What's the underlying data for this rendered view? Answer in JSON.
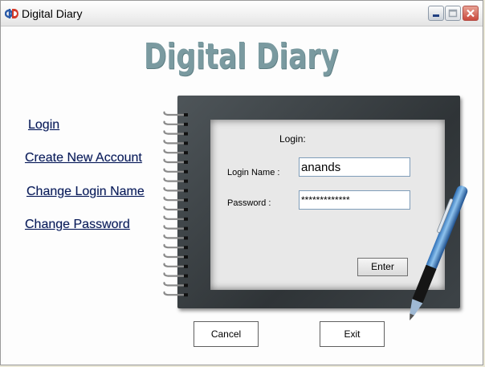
{
  "window": {
    "title": "Digital Diary",
    "icon_name": "digital-diary-app-icon",
    "controls": [
      "minimize-icon",
      "maximize-icon",
      "close-icon"
    ]
  },
  "header": {
    "app_title": "Digital Diary"
  },
  "sidebar": {
    "links": [
      {
        "label": "Login"
      },
      {
        "label": "Create New Account"
      },
      {
        "label": "Change Login Name"
      },
      {
        "label": "Change Password"
      }
    ]
  },
  "login_panel": {
    "heading": "Login:",
    "login_name_label": "Login Name :",
    "login_name_value": "anands",
    "password_label": "Password :",
    "password_value": "*************",
    "enter_label": "Enter"
  },
  "footer": {
    "cancel_label": "Cancel",
    "exit_label": "Exit"
  },
  "colors": {
    "title_text": "#7a9aa0",
    "link": "#0a1a55",
    "notebook": "#3a4043",
    "close_button": "#c9493c"
  }
}
